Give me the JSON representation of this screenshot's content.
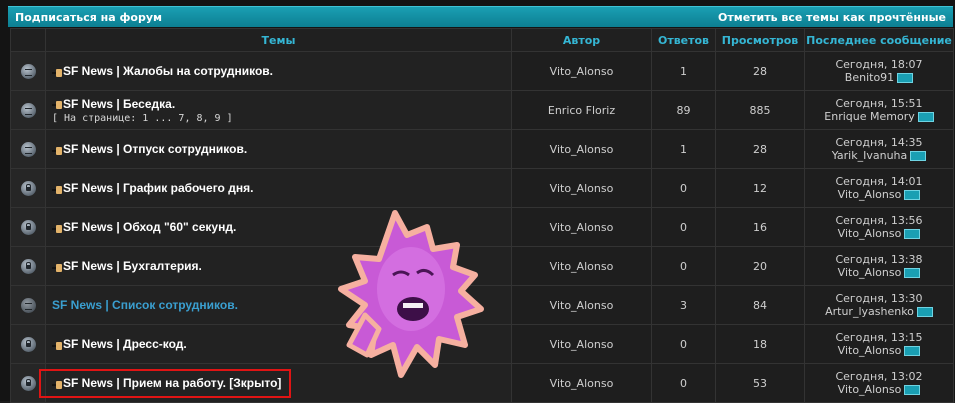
{
  "header": {
    "subscribe": "Подписаться на форум",
    "mark_read": "Отметить все темы как прочтённые"
  },
  "columns": {
    "topics": "Темы",
    "author": "Автор",
    "replies": "Ответов",
    "views": "Просмотров",
    "last": "Последнее сообщение"
  },
  "rows": [
    {
      "title": "SF News | Жалобы на сотрудников.",
      "author": "Vito_Alonso",
      "replies": "1",
      "views": "28",
      "last_time": "Сегодня, 18:07",
      "last_user": "Benito91",
      "icon": "folder-icon"
    },
    {
      "title": "SF News | Беседка.",
      "pages": "[  На странице: 1 ... 7, 8, 9 ]",
      "author": "Enrico Floriz",
      "replies": "89",
      "views": "885",
      "last_time": "Сегодня, 15:51",
      "last_user": "Enrique Memory",
      "icon": "folder-icon"
    },
    {
      "title": "SF News | Отпуск сотрудников.",
      "author": "Vito_Alonso",
      "replies": "1",
      "views": "28",
      "last_time": "Сегодня, 14:35",
      "last_user": "Yarik_Ivanuha",
      "icon": "folder-icon"
    },
    {
      "title": "SF News | График рабочего дня.",
      "author": "Vito_Alonso",
      "replies": "0",
      "views": "12",
      "last_time": "Сегодня, 14:01",
      "last_user": "Vito_Alonso",
      "icon": "lock-icon"
    },
    {
      "title": "SF News | Обход \"60\" секунд.",
      "author": "Vito_Alonso",
      "replies": "0",
      "views": "16",
      "last_time": "Сегодня, 13:56",
      "last_user": "Vito_Alonso",
      "icon": "lock-icon"
    },
    {
      "title": "SF News | Бухгалтерия.",
      "author": "Vito_Alonso",
      "replies": "0",
      "views": "20",
      "last_time": "Сегодня, 13:38",
      "last_user": "Vito_Alonso",
      "icon": "lock-icon"
    },
    {
      "title": "SF News | Список сотрудников.",
      "author": "Vito_Alonso",
      "replies": "3",
      "views": "84",
      "last_time": "Сегодня, 13:30",
      "last_user": "Artur_lyashenko",
      "icon": "folder-icon"
    },
    {
      "title": "SF News | Дресс-код.",
      "author": "Vito_Alonso",
      "replies": "0",
      "views": "18",
      "last_time": "Сегодня, 13:15",
      "last_user": "Vito_Alonso",
      "icon": "lock-icon"
    },
    {
      "title": "SF News | Прием на работу. [Зкрыто]",
      "author": "Vito_Alonso",
      "replies": "0",
      "views": "53",
      "last_time": "Сегодня, 13:02",
      "last_user": "Vito_Alonso",
      "icon": "lock-icon"
    }
  ],
  "colors": {
    "accent": "#1a9fb3",
    "header_text": "#35b6d4",
    "highlight": "#e01414"
  }
}
